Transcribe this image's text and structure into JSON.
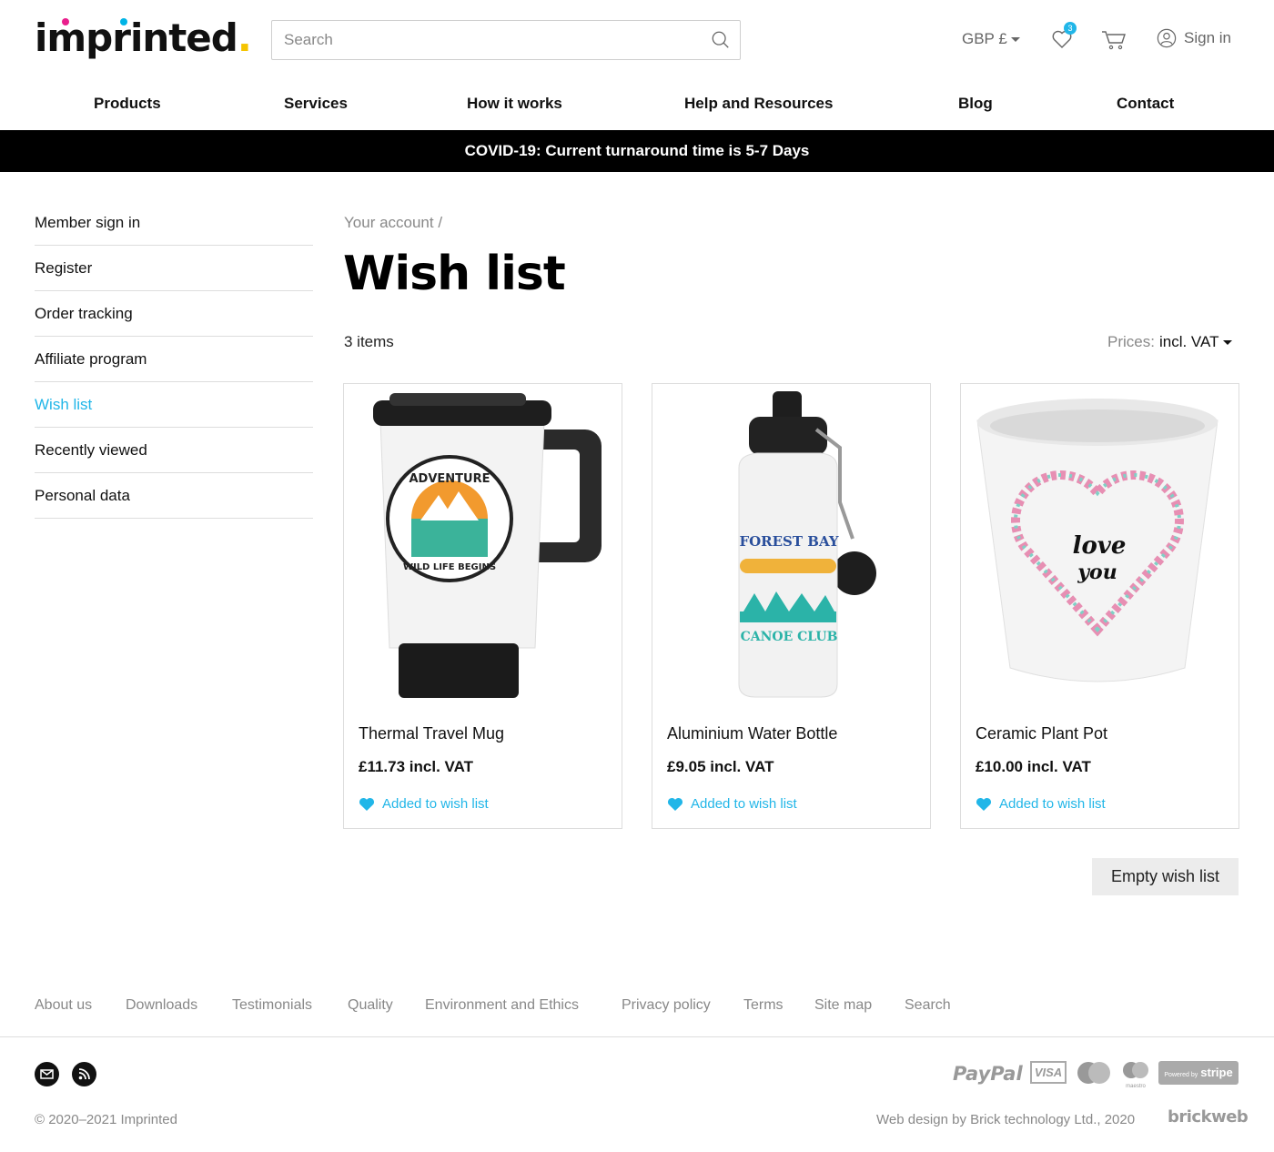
{
  "header": {
    "logo_text": "imprinted",
    "logo_dot": ".",
    "search_placeholder": "Search",
    "currency": "GBP £",
    "wishlist_count": "3",
    "signin": "Sign in"
  },
  "nav": {
    "items": [
      "Products",
      "Services",
      "How it works",
      "Help and Resources",
      "Blog",
      "Contact"
    ]
  },
  "banner": "COVID-19: Current turnaround time is 5-7 Days",
  "sidebar": {
    "items": [
      "Member sign in",
      "Register",
      "Order tracking",
      "Affiliate program",
      "Wish list",
      "Recently viewed",
      "Personal data"
    ]
  },
  "main": {
    "breadcrumb": "Your account /",
    "title": "Wish list",
    "items_count": "3 items",
    "prices_label": "Prices:",
    "prices_value": "incl. VAT",
    "products": [
      {
        "name": "Thermal Travel Mug",
        "price": "£11.73 incl. VAT",
        "wish": "Added to wish list",
        "art_top": "ADVENTURE",
        "art_bottom": "WILD LIFE BEGINS"
      },
      {
        "name": "Aluminium Water Bottle",
        "price": "£9.05 incl. VAT",
        "wish": "Added to wish list",
        "art_top": "FOREST BAY",
        "art_bottom": "CANOE CLUB"
      },
      {
        "name": "Ceramic Plant Pot",
        "price": "£10.00 incl. VAT",
        "wish": "Added to wish list",
        "art_top": "love",
        "art_bottom": "you"
      }
    ],
    "empty_button": "Empty wish list"
  },
  "footer": {
    "links": [
      "About us",
      "Downloads",
      "Testimonials",
      "Quality",
      "Environment and Ethics",
      "Privacy policy",
      "Terms",
      "Site map",
      "Search"
    ],
    "copyright": "© 2020–2021 Imprinted",
    "credit": "Web design by Brick technology Ltd., 2020",
    "credit_logo": "brickweb",
    "payments": {
      "paypal": "PayPal",
      "visa": "VISA",
      "maestro": "maestro",
      "stripe_small": "Powered by",
      "stripe": "stripe"
    }
  },
  "colors": {
    "accent": "#21b6e8",
    "banner_bg": "#000000"
  }
}
